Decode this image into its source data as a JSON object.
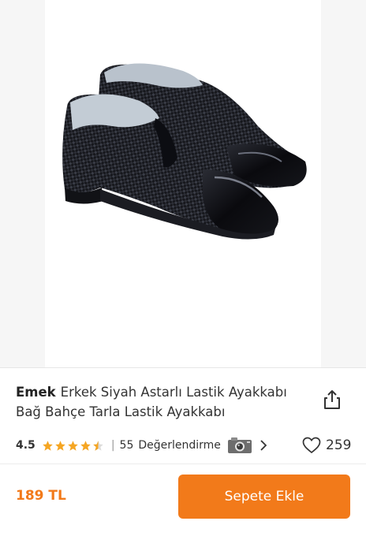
{
  "product": {
    "image_alt": "Erkek Siyah Astarlı Lastik Ayakkabı",
    "brand": "Emek",
    "title": "Erkek Siyah Astarlı Lastik Ayakkabı Bağ Bahçe Tarla Lastik Ayakkabı"
  },
  "rating": {
    "value": "4.5",
    "stars": 4.5,
    "max_stars": 5,
    "separator": "|",
    "review_count": "55",
    "review_label": "Değerlendirme"
  },
  "favorites": {
    "count": "259"
  },
  "purchase": {
    "price": "189 TL",
    "add_to_cart_label": "Sepete Ekle"
  },
  "colors": {
    "accent": "#f27a1a",
    "star": "#f5a623"
  },
  "icons": [
    "share-icon",
    "star-icon",
    "camera-icon",
    "chevron-right-icon",
    "heart-icon"
  ]
}
